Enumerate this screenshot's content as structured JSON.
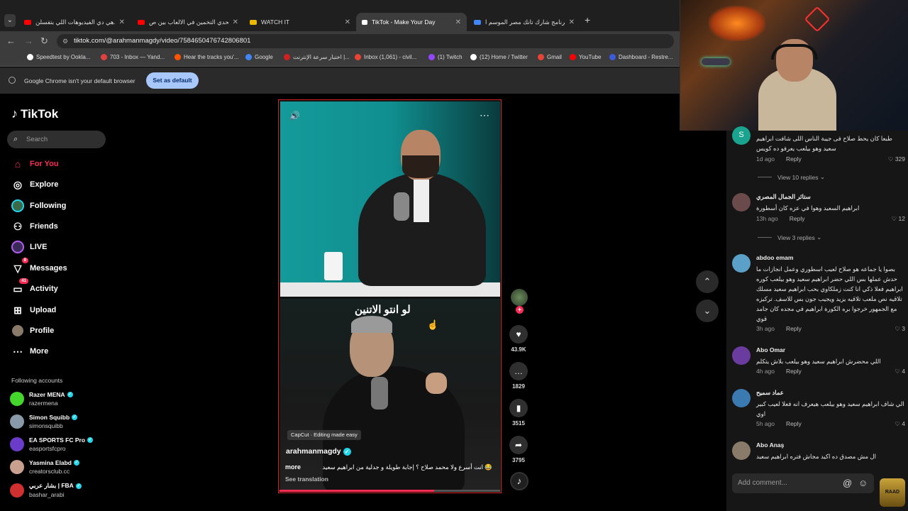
{
  "browser": {
    "tabs": [
      {
        "title": "هي دي الفيديوهات اللي بتفسلن...",
        "favicon_color": "#ff0000",
        "active": false
      },
      {
        "title": "تحدي التخمين في الالعاب بين ص...",
        "favicon_color": "#ff0000",
        "active": false
      },
      {
        "title": "WATCH IT",
        "favicon_color": "#e8b800",
        "active": false
      },
      {
        "title": "TikTok - Make Your Day",
        "favicon_color": "#ffffff",
        "active": true
      },
      {
        "title": "برنامج شارك تانك مصر الموسم ا...",
        "favicon_color": "#4285f4",
        "active": false
      }
    ],
    "url": "tiktok.com/@arahmanmagdy/video/7584650476742806801",
    "bookmarks": [
      {
        "label": "Speedtest by Ookla...",
        "color": "#ffffff"
      },
      {
        "label": "703 - Inbox — Yand...",
        "color": "#e04040"
      },
      {
        "label": "Hear the tracks you'...",
        "color": "#ff5500"
      },
      {
        "label": "Google",
        "color": "#4285f4"
      },
      {
        "label": "اختبار سرعة الإنترنت |...",
        "color": "#d02020"
      },
      {
        "label": "Inbox (1,061) - civil...",
        "color": "#ea4335"
      },
      {
        "label": "(1) Twitch",
        "color": "#9146ff"
      },
      {
        "label": "(12) Home / Twitter",
        "color": "#ffffff"
      },
      {
        "label": "Gmail",
        "color": "#ea4335"
      },
      {
        "label": "YouTube",
        "color": "#ff0000"
      },
      {
        "label": "Dashboard - Restre...",
        "color": "#3b5bdb"
      }
    ],
    "default_bar": {
      "message": "Google Chrome isn't your default browser",
      "button": "Set as default"
    }
  },
  "sidebar": {
    "logo": "TikTok",
    "search_placeholder": "Search",
    "nav": [
      {
        "label": "For You",
        "icon": "home-icon",
        "active": true
      },
      {
        "label": "Explore",
        "icon": "compass-icon",
        "active": false
      },
      {
        "label": "Following",
        "icon": "following-icon",
        "active": false
      },
      {
        "label": "Friends",
        "icon": "friends-icon",
        "active": false
      },
      {
        "label": "LIVE",
        "icon": "live-icon",
        "active": false
      },
      {
        "label": "Messages",
        "icon": "messages-icon",
        "badge": "8",
        "active": false
      },
      {
        "label": "Activity",
        "icon": "activity-icon",
        "badge": "41",
        "active": false
      },
      {
        "label": "Upload",
        "icon": "upload-icon",
        "active": false
      },
      {
        "label": "Profile",
        "icon": "profile-icon",
        "active": false
      },
      {
        "label": "More",
        "icon": "more-icon",
        "active": false
      }
    ],
    "following_header": "Following accounts",
    "following": [
      {
        "name": "Razer MENA",
        "handle": "razermena",
        "color": "#44d62c"
      },
      {
        "name": "Simon Squibb",
        "handle": "simonsquibb",
        "color": "#8899aa"
      },
      {
        "name": "EA SPORTS FC Pro",
        "handle": "easportsfcpro",
        "color": "#6a3cc9"
      },
      {
        "name": "Yasmina Elabd",
        "handle": "creatorsclub.cc",
        "color": "#c9a090"
      },
      {
        "name": "بشار عربي | FBA",
        "handle": "bashar_arabi",
        "color": "#d03030"
      }
    ]
  },
  "video": {
    "overlay_text": "لو انتو الاتنين",
    "capcut": "CapCut · Editing made easy",
    "author": "arahmanmagdy",
    "caption": "😂 انت أسرع ولا محمد صلاح ؟ إجابة طويلة و جدلية من ابراهيم سعيد",
    "caption_more": "more",
    "see_translation": "See translation",
    "progress": 0.7
  },
  "actions": [
    {
      "icon": "heart-icon",
      "count": "43.9K"
    },
    {
      "icon": "comment-icon",
      "count": "1829"
    },
    {
      "icon": "bookmark-icon",
      "count": "3515"
    },
    {
      "icon": "share-icon",
      "count": "3795"
    }
  ],
  "comments": [
    {
      "user": "",
      "text": "طبعا كان يحط صلاح فى جيبة الناس اللى شافت ابراهيم سعيد وهو بيلعب يعرفو ده كويس",
      "time": "1d ago",
      "reply": "Reply",
      "likes": "329",
      "avatar_color": "#1aa38f",
      "avatar_letter": "S"
    },
    {
      "user": "ستائر الجمال المصري",
      "text": "ابراهيم السعيد وهوا في عزه كان أسطورة",
      "time": "13h ago",
      "reply": "Reply",
      "likes": "12",
      "avatar_color": "#6a4a4a"
    },
    {
      "user": "abdoo emam",
      "text": "بصوا يا جماعه هو صلاح لعيب اسطوري وعمل انجازات ما حدش عملها بس اللي حضر ابراهيم سعيد وهو بيلعب كوره ابراهيم فعلا ذكي انا كنت زملكاوي بحب ابراهيم سعيد مسلك تلاقيه نص ملعب تلاقيه يزيد ويجيب جون بس للاسف. تركيزه مع الجمهور خرجوا بره الكورة ابراهيم في مجده كان جامد قوي",
      "time": "3h ago",
      "reply": "Reply",
      "likes": "3",
      "avatar_color": "#5aa0c8"
    },
    {
      "user": "Abo Omar",
      "text": "اللي محضرش ابراهيم سعيد وهو بيلعب بلاش يتكلم",
      "time": "4h ago",
      "reply": "Reply",
      "likes": "4",
      "avatar_color": "#6a3ca0"
    },
    {
      "user": "عماد سميح",
      "text": "الي شاف ابراهيم سعيد وهو بيلعب هيعرف انه فعلا لعيب كبير اوي",
      "time": "5h ago",
      "reply": "Reply",
      "likes": "4",
      "avatar_color": "#3a7ab0"
    },
    {
      "user": "Abo Anaş",
      "text": "ال مش مصدق ده اكيد مجاش فتره ابراهيم سعيد",
      "time": "",
      "reply": "",
      "likes": "",
      "avatar_color": "#8a7a6a"
    }
  ],
  "view_replies": [
    "View 10 replies",
    "View 3 replies"
  ],
  "add_comment_placeholder": "Add comment...",
  "streamer_badge": "RAAD"
}
